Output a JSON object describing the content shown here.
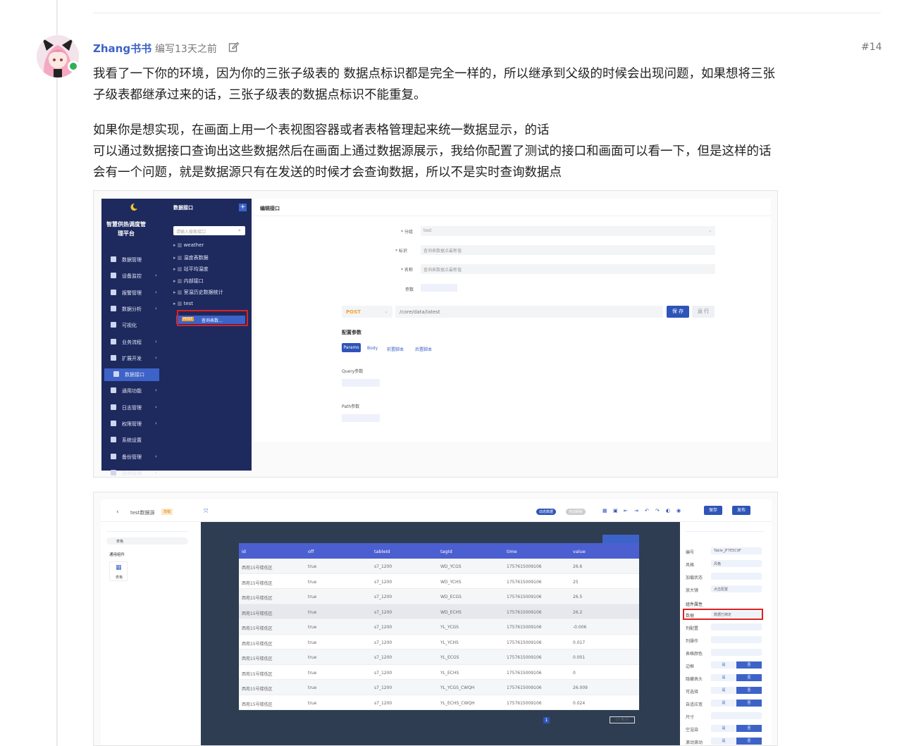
{
  "post": {
    "author": "Zhang书书",
    "meta": "编写13天之前",
    "number": "#14",
    "paragraphs": [
      "我看了一下你的环境，因为你的三张子级表的 数据点标识都是完全一样的，所以继承到父级的时候会出现问题，如果想将三张",
      "子级表都继承过来的话，三张子级表的数据点标识不能重复。",
      "如果你是想实现，在画面上用一个表视图容器或者表格管理起来统一数据显示，的话",
      "可以通过数据接口查询出这些数据然后在画面上通过数据源展示，我给你配置了测试的接口和画面可以看一下，但是这样的话",
      "会有一个问题，就是数据源只有在发送的时候才会查询数据，所以不是实时查询数据点"
    ]
  },
  "shot1": {
    "platform": "智慧供热调度管理平台",
    "menu": [
      {
        "label": "数据管理",
        "arrow": ""
      },
      {
        "label": "设备监控",
        "arrow": "›"
      },
      {
        "label": "报警管理",
        "arrow": "›"
      },
      {
        "label": "数据分析",
        "arrow": "›"
      },
      {
        "label": "可视化",
        "arrow": ""
      },
      {
        "label": "业务流程",
        "arrow": "›"
      },
      {
        "label": "扩展开发",
        "arrow": "›"
      },
      {
        "label": "数据接口",
        "arrow": ""
      },
      {
        "label": "通用功能",
        "arrow": "›"
      },
      {
        "label": "日志管理",
        "arrow": "›"
      },
      {
        "label": "权限管理",
        "arrow": "›"
      },
      {
        "label": "系统设置",
        "arrow": ""
      },
      {
        "label": "备份管理",
        "arrow": "›"
      },
      {
        "label": "视频管理",
        "arrow": "›"
      }
    ],
    "tree_title": "数据接口",
    "tree_search": "请输入搜索接口",
    "tree": [
      "weather",
      "温度表数据",
      "站平均温度",
      "内部接口",
      "室温历史数据统计",
      "test"
    ],
    "tree_selected_method": "POST",
    "tree_selected": "查询表数...",
    "form_title": "编辑接口",
    "labels": {
      "group": "* 分组",
      "ident": "* 标识",
      "name": "* 名称",
      "params": "参数"
    },
    "values": {
      "group": "test",
      "ident": "查询表数据点最新值",
      "name": "查询表数据点最新值"
    },
    "method": "POST",
    "url": "/core/data/latest",
    "save": "保 存",
    "run": "运 行",
    "config_title": "配置参数",
    "tabs": [
      "Params",
      "Body",
      "前置脚本",
      "后置脚本"
    ],
    "query_label": "Query参数",
    "path_label": "Path参数"
  },
  "shot2": {
    "back": "‹",
    "page_name": "test数据源",
    "page_badge": "草稿",
    "toggle1": "动态数据",
    "toggle2": "自动刷新",
    "save": "保存",
    "publish": "发布",
    "search_value": "表格",
    "group_label": "通用组件",
    "widget_label": "表格",
    "columns": [
      "id",
      "off",
      "tableId",
      "tagId",
      "time",
      "value"
    ],
    "rows": [
      [
        "西苑15号楼低区",
        "true",
        "s7_1200",
        "WD_YCGS",
        "1757615009106",
        "26.6"
      ],
      [
        "西苑15号楼低区",
        "true",
        "s7_1200",
        "WD_YCHS",
        "1757615009106",
        "25"
      ],
      [
        "西苑15号楼低区",
        "true",
        "s7_1200",
        "WD_ECGS",
        "1757615009106",
        "26.5"
      ],
      [
        "西苑15号楼低区",
        "true",
        "s7_1200",
        "WD_ECHS",
        "1757615009106",
        "26.2"
      ],
      [
        "西苑15号楼低区",
        "true",
        "s7_1200",
        "YL_YCGS",
        "1757615009106",
        "-0.006"
      ],
      [
        "西苑15号楼低区",
        "true",
        "s7_1200",
        "YL_YCHS",
        "1757615009106",
        "0.017"
      ],
      [
        "西苑15号楼低区",
        "true",
        "s7_1200",
        "YL_ECGS",
        "1757615009106",
        "0.001"
      ],
      [
        "西苑15号楼低区",
        "true",
        "s7_1200",
        "YL_ECHS",
        "1757615009106",
        "0"
      ],
      [
        "西苑15号楼低区",
        "true",
        "s7_1200",
        "YL_YCGS_CWQH",
        "1757615009106",
        "26.009"
      ],
      [
        "西苑15号楼低区",
        "true",
        "s7_1200",
        "YL_ECHS_CWQH",
        "1757615009106",
        "0.024"
      ]
    ],
    "page_current": "1",
    "page_size": "10 条/页",
    "props": {
      "id_label": "编号",
      "id_value": "Table_JF7E5C9F",
      "style_label": "风格",
      "style_value": "风格",
      "load_label": "加载状态",
      "enlarge_label": "放大镜",
      "enlarge_value": "点击配置",
      "section": "组件属性",
      "data_label": "数据",
      "data_value": "数据已绑定",
      "colcfg_label": "列配置",
      "colop_label": "列操作",
      "bgcolor_label": "表格颜色",
      "border_label": "边框",
      "hidehead_label": "隐藏表头",
      "select_label": "可选择",
      "auto_label": "自适应宽",
      "size_label": "尺寸",
      "empty_label": "空渲染",
      "scroll_label": "滚动滚动",
      "yes": "是",
      "no": "否"
    }
  }
}
